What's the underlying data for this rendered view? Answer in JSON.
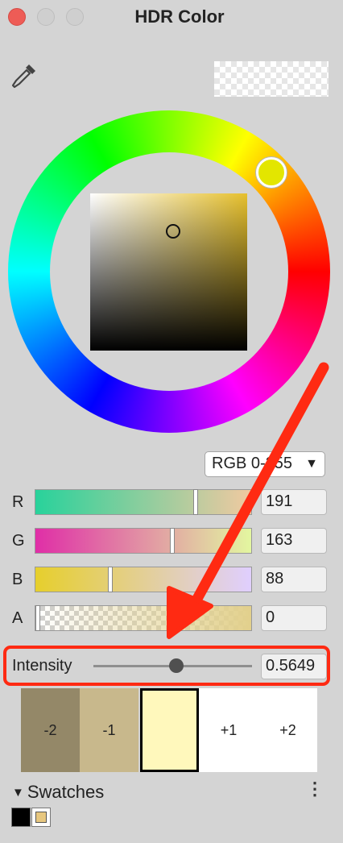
{
  "window": {
    "title": "HDR Color"
  },
  "toolbar": {
    "eyedropper_icon": "eyedropper-icon"
  },
  "color_mode": {
    "selected": "RGB 0-255",
    "arrow_icon": "triangle-down-icon"
  },
  "channels": [
    {
      "label": "R",
      "value": "191"
    },
    {
      "label": "G",
      "value": "163"
    },
    {
      "label": "B",
      "value": "88"
    },
    {
      "label": "A",
      "value": "0"
    }
  ],
  "intensity": {
    "label": "Intensity",
    "value": "0.5649"
  },
  "exposure_swatches": [
    {
      "label": "-2",
      "color": "#948868"
    },
    {
      "label": "-1",
      "color": "#c8b88c"
    },
    {
      "label": "",
      "color": "#fff8bc"
    },
    {
      "label": "+1",
      "color": "#ffffff"
    },
    {
      "label": "+2",
      "color": "#ffffff"
    }
  ],
  "swatches": {
    "label": "Swatches",
    "menu_icon": "vertical-ellipsis-icon",
    "items": [
      {
        "color": "#000000"
      },
      {
        "color": "#e7c77f"
      }
    ]
  },
  "annotation": {
    "color": "#ff2a12"
  }
}
